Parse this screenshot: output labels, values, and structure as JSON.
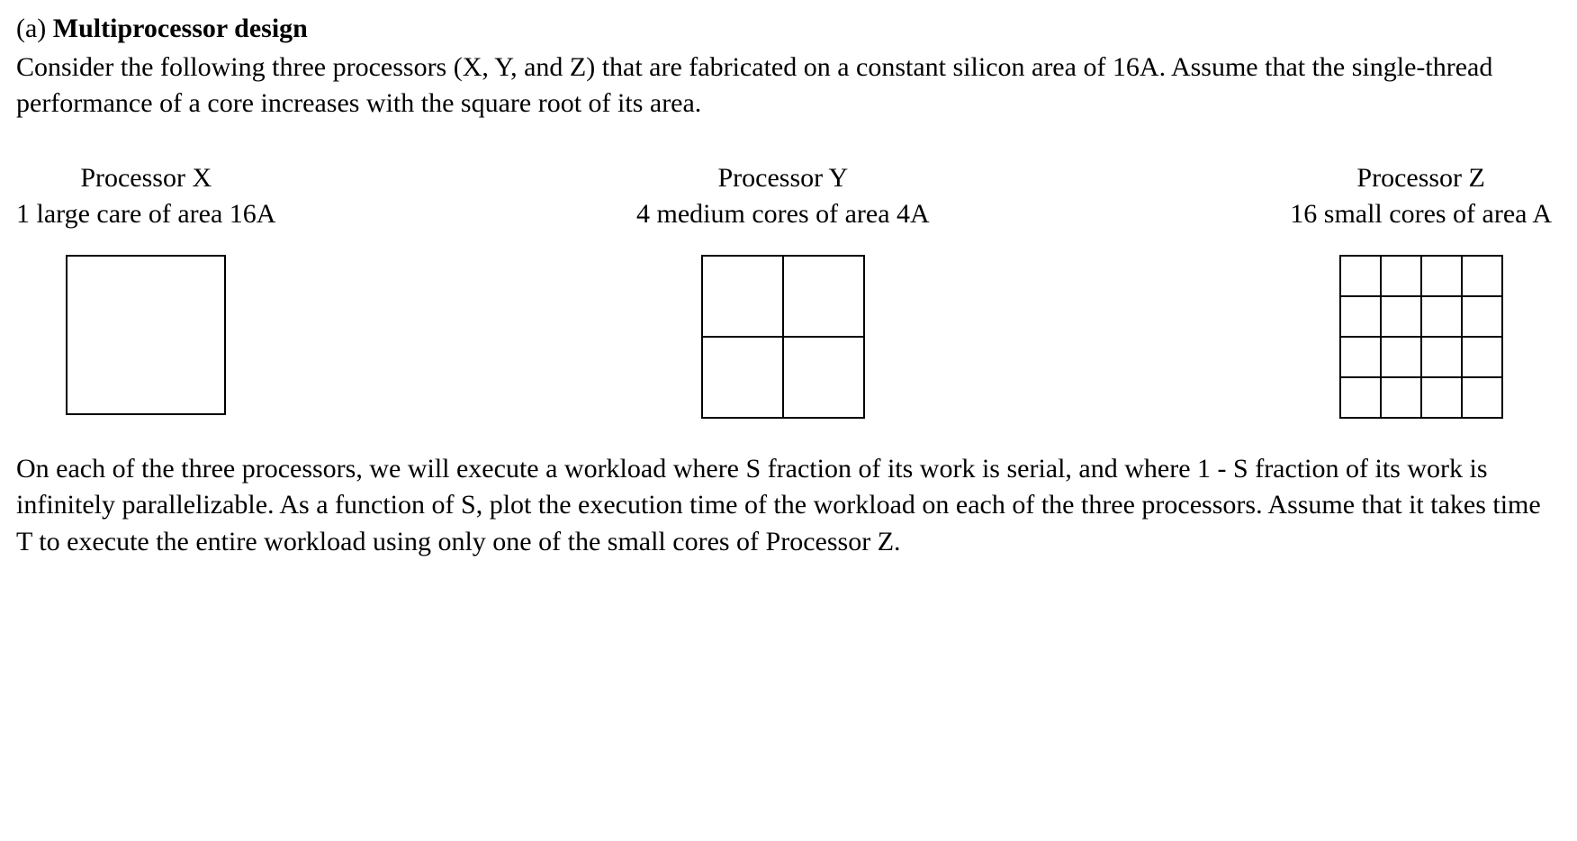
{
  "heading": {
    "part": "(a)",
    "title": "Multiprocessor design"
  },
  "intro": "Consider the following three processors (X, Y, and Z) that are fabricated on a constant silicon area of 16A. Assume that the single-thread performance of a core increases with the square root of its area.",
  "processors": {
    "x": {
      "name": "Processor X",
      "desc": "1 large care of area 16A"
    },
    "y": {
      "name": "Processor Y",
      "desc": "4 medium cores of area 4A"
    },
    "z": {
      "name": "Processor Z",
      "desc": "16 small cores of area A"
    }
  },
  "question": "On each of the three processors, we will execute a workload where S fraction of its work is serial, and where 1 - S fraction of its work is infinitely parallelizable. As a function of S, plot the execution time of the workload on each of the three processors. Assume that it takes time T to execute the entire workload using only one of the small cores of Processor Z."
}
